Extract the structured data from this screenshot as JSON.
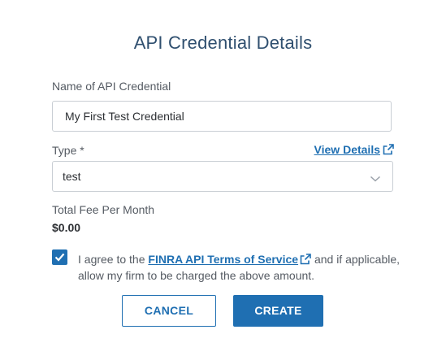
{
  "dialog": {
    "title": "API Credential Details"
  },
  "name_field": {
    "label": "Name of API Credential",
    "value": "My First Test Credential"
  },
  "type_field": {
    "label": "Type *",
    "view_details_label": "View Details",
    "selected_value": "test"
  },
  "fee": {
    "label": "Total Fee Per Month",
    "value": "$0.00"
  },
  "agreement": {
    "checked": true,
    "text_before": "I agree to the ",
    "link_label": "FINRA API Terms of Service",
    "text_after": " and if applicable, allow my firm to be charged the above amount."
  },
  "buttons": {
    "cancel_label": "CANCEL",
    "create_label": "CREATE"
  },
  "colors": {
    "accent": "#1f6fb2",
    "title": "#2f4f6f",
    "border": "#c9ced4"
  },
  "icons": {
    "external_link": "external-link-icon",
    "chevron": "chevron-down-icon",
    "check": "checkmark-icon"
  }
}
